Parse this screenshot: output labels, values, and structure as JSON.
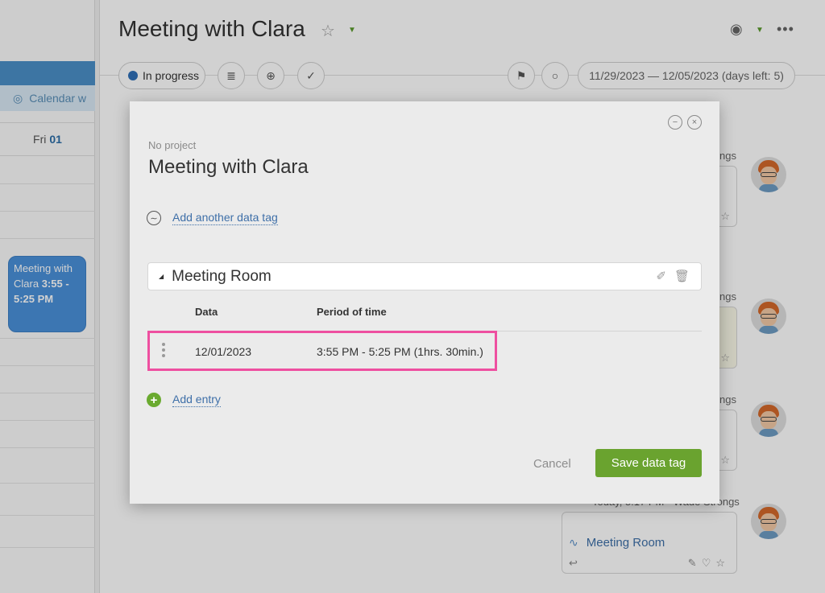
{
  "background": {
    "calendar_link": "Calendar w",
    "day_header": {
      "day": "Fri",
      "date": "01"
    },
    "event": {
      "title": "Meeting with Clara",
      "time": "3:55 - 5:25 PM"
    },
    "page_title": "Meeting with Clara",
    "status": "In progress",
    "date_range": "11/29/2023 — 12/05/2023  (days left: 5)",
    "feed": {
      "labels": [
        "ngs",
        "ngs",
        "ngs",
        "Today, 5:17 PM · Wade Strongs"
      ],
      "tag_name": "Meeting Room"
    }
  },
  "modal": {
    "project_label": "No project",
    "title": "Meeting with Clara",
    "add_tag_label": "Add another data tag",
    "section_title": "Meeting Room",
    "columns": {
      "data": "Data",
      "period": "Period of time"
    },
    "entry": {
      "date": "12/01/2023",
      "period": "3:55 PM - 5:25 PM (1hrs. 30min.)"
    },
    "add_entry_label": "Add entry",
    "cancel_label": "Cancel",
    "save_label": "Save data tag"
  },
  "colors": {
    "accent_green": "#6aa32f",
    "link_blue": "#3e6fa8",
    "highlight_pink": "#ee4fa0",
    "status_blue": "#2f6fb7"
  }
}
